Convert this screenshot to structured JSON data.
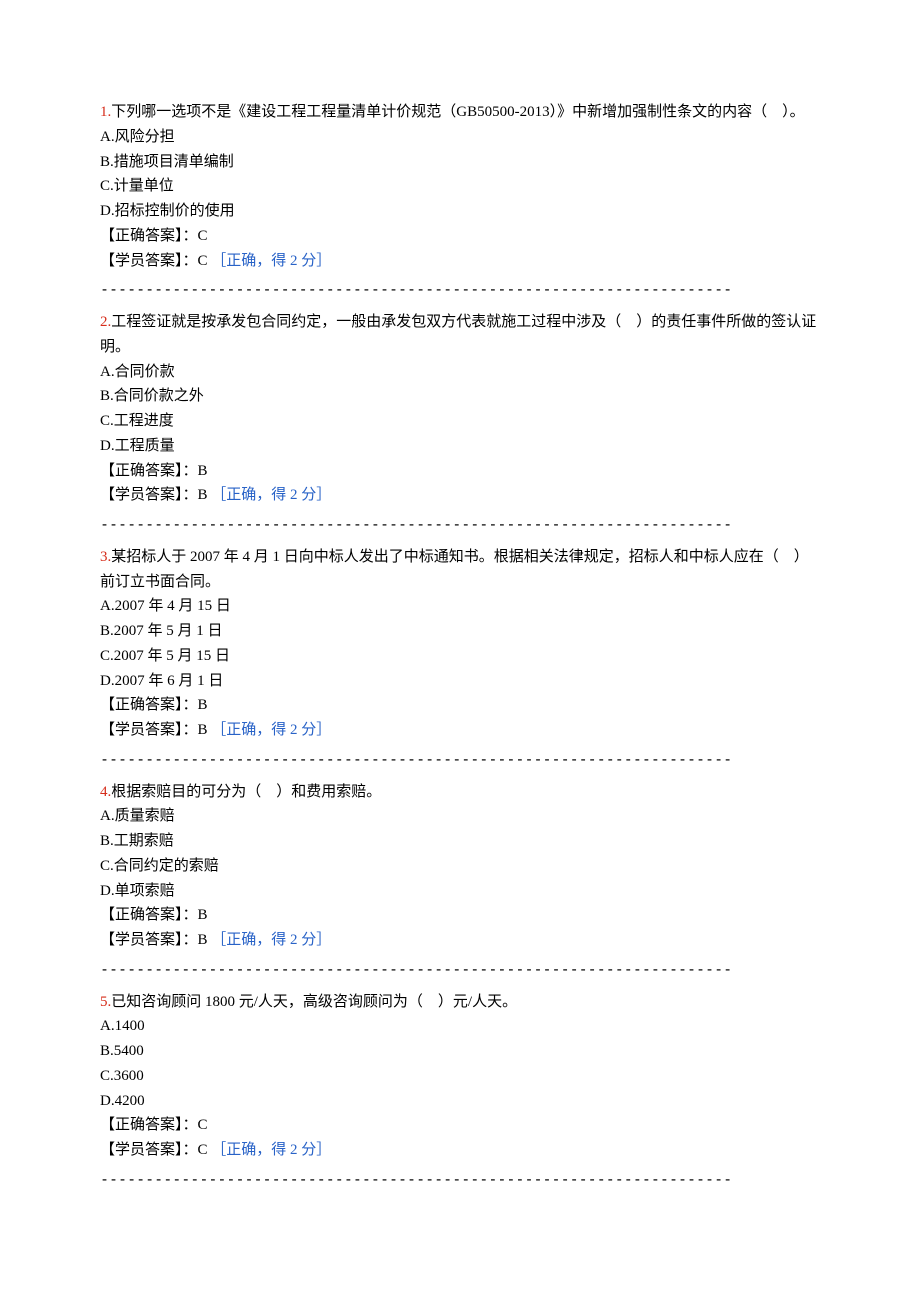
{
  "divider": "----------------------------------------------------------------------",
  "labels": {
    "correct_answer_prefix": "【正确答案】：",
    "student_answer_prefix": "【学员答案】：",
    "correct_note": "［正确，得 2 分］"
  },
  "questions": [
    {
      "num": "1.",
      "text": "下列哪一选项不是《建设工程工程量清单计价规范（GB50500-2013）》中新增加强制性条文的内容（　）。",
      "options": [
        "A.风险分担",
        "B.措施项目清单编制",
        "C.计量单位",
        "D.招标控制价的使用"
      ],
      "correct": "C",
      "student": "C"
    },
    {
      "num": "2.",
      "text": "工程签证就是按承发包合同约定，一般由承发包双方代表就施工过程中涉及（　）的责任事件所做的签认证明。",
      "options": [
        "A.合同价款",
        "B.合同价款之外",
        "C.工程进度",
        "D.工程质量"
      ],
      "correct": "B",
      "student": "B"
    },
    {
      "num": "3.",
      "text": "某招标人于 2007 年 4 月 1 日向中标人发出了中标通知书。根据相关法律规定，招标人和中标人应在（　）前订立书面合同。",
      "options": [
        "A.2007 年 4 月 15 日",
        "B.2007 年 5 月 1 日",
        "C.2007 年 5 月 15 日",
        "D.2007 年 6 月 1 日"
      ],
      "correct": "B",
      "student": "B"
    },
    {
      "num": "4.",
      "text": "根据索赔目的可分为（　）和费用索赔。",
      "options": [
        "A.质量索赔",
        "B.工期索赔",
        "C.合同约定的索赔",
        "D.单项索赔"
      ],
      "correct": "B",
      "student": "B"
    },
    {
      "num": "5.",
      "text": "已知咨询顾问 1800 元/人天，高级咨询顾问为（　）元/人天。",
      "options": [
        "A.1400",
        "B.5400",
        "C.3600",
        "D.4200"
      ],
      "correct": "C",
      "student": "C"
    }
  ]
}
